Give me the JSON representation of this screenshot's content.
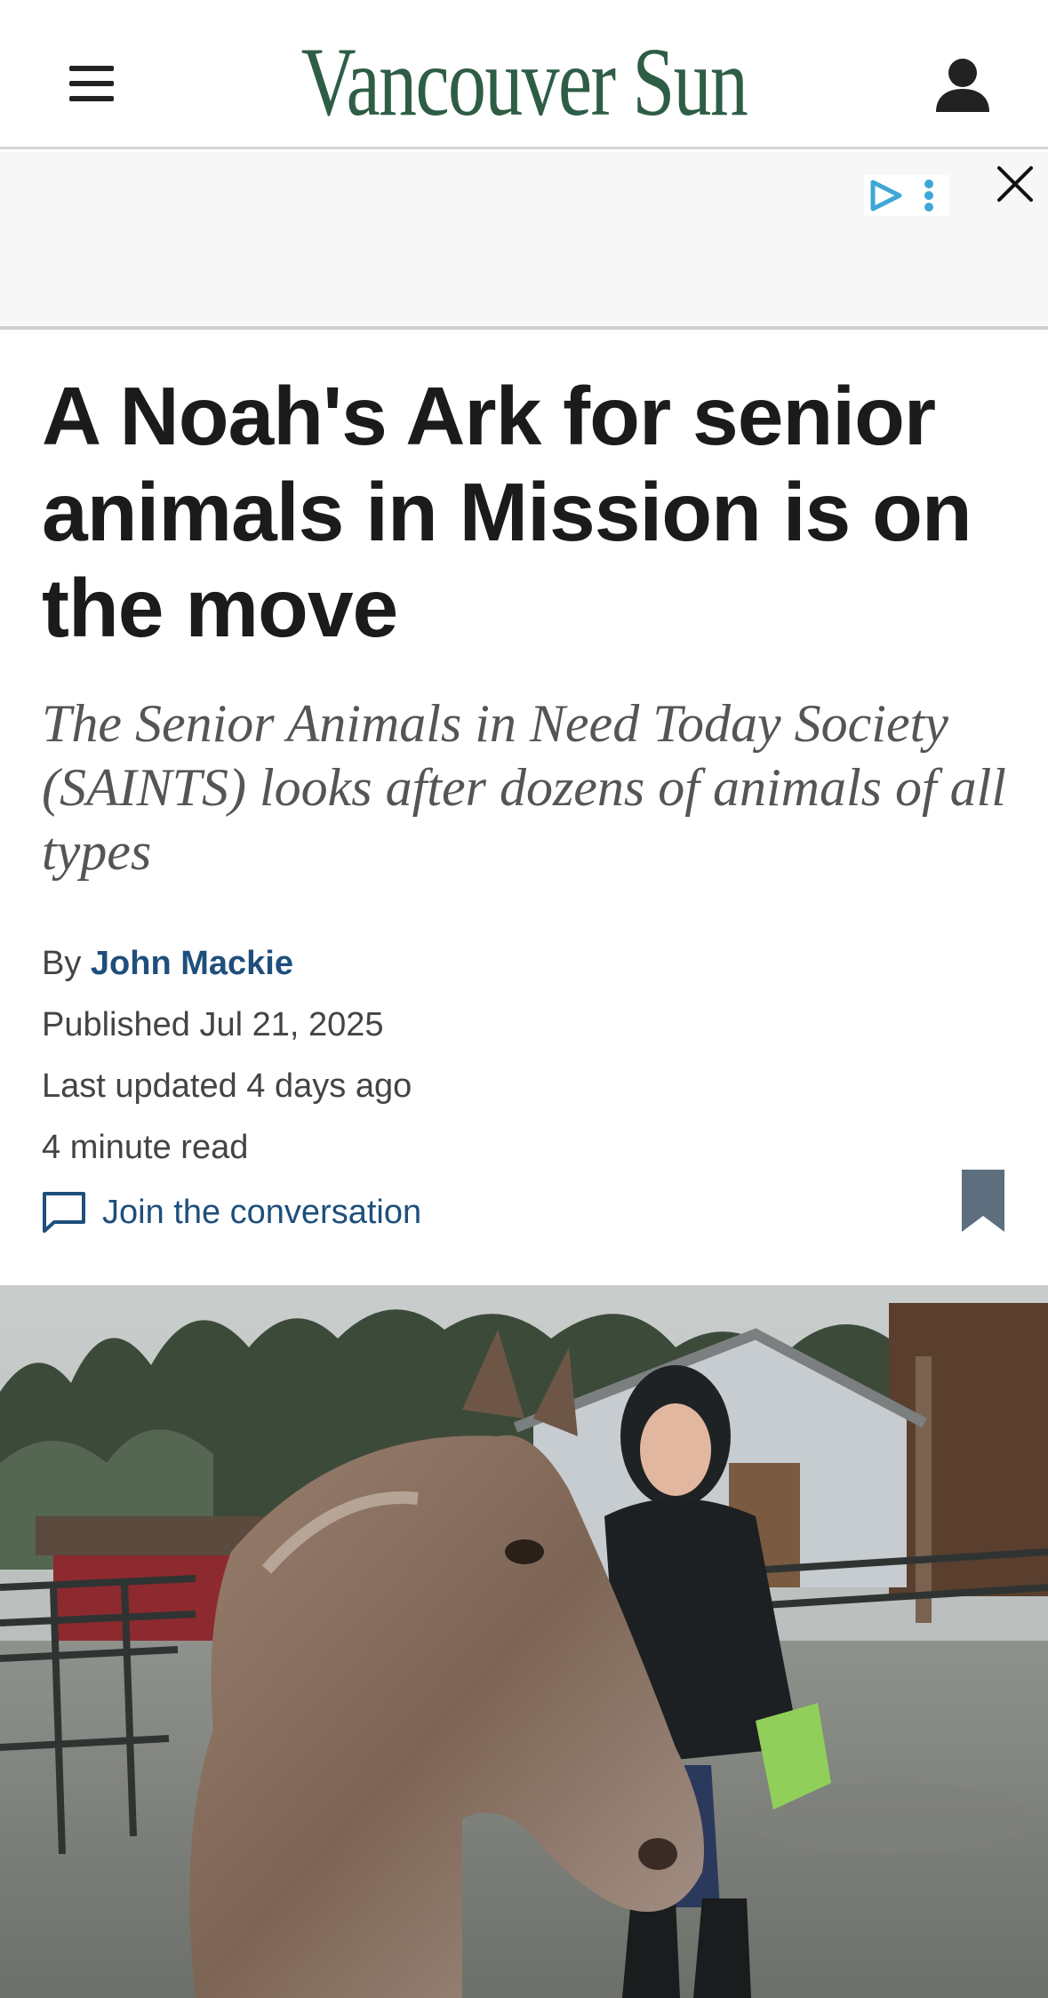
{
  "header": {
    "brand_name": "Vancouver Sun",
    "brand_color": "#2e5d46",
    "menu_icon": "hamburger-menu-icon",
    "account_icon": "user-account-icon"
  },
  "ad": {
    "badge_icons": [
      "adchoices-play-icon",
      "more-vertical-icon"
    ],
    "close_icon": "close-icon"
  },
  "article": {
    "headline": "A Noah's Ark for senior animals in Mission is on the move",
    "deck": "The Senior Animals in Need Today Society (SAINTS) looks after dozens of animals of all types",
    "byline_prefix": "By",
    "author": "John Mackie",
    "published": "Published Jul 21, 2025",
    "updated": "Last updated 4 days ago",
    "read_time": "4 minute read",
    "conversation_label": "Join the conversation",
    "conversation_icon": "comment-icon",
    "bookmark_icon": "bookmark-icon",
    "link_color": "#1e4f7c"
  },
  "hero_image": {
    "alt": "photo-horse-and-woman-in-rain"
  }
}
